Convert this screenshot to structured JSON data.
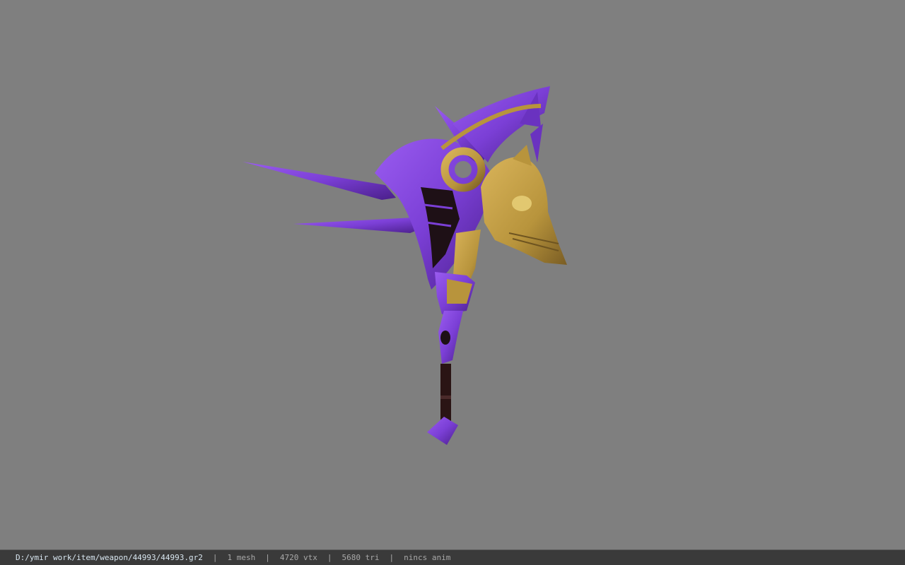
{
  "viewer": {
    "background_color": "#7f7f7f",
    "model_icon": "purple-skull-axe-weapon-model"
  },
  "status": {
    "path": "D:/ymir work/item/weapon/44993/44993.gr2",
    "separator": "|",
    "mesh": "1 mesh",
    "vertices": "4720 vtx",
    "triangles": "5680 tri",
    "anim": "nincs anim"
  },
  "colors": {
    "purple": "#7b3fd6",
    "purple_dark": "#4a1f8a",
    "gold": "#b8943c",
    "gold_dark": "#6e5420",
    "shaft": "#2a1414"
  }
}
